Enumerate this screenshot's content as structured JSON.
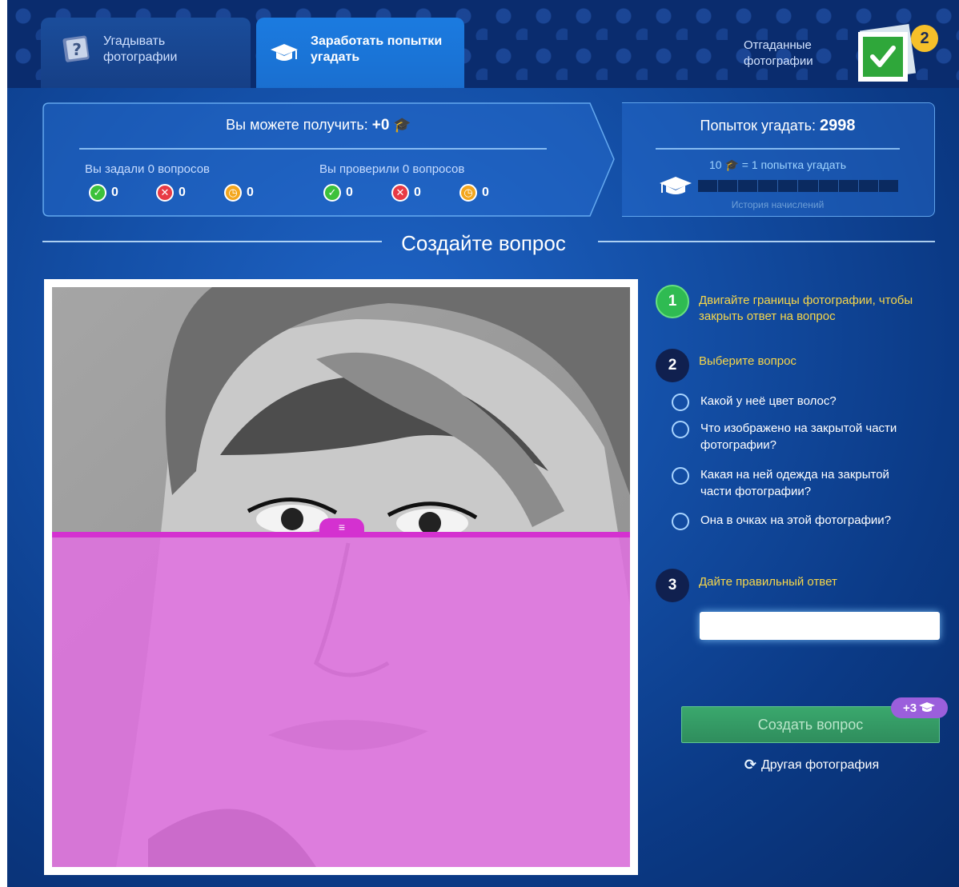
{
  "tabs": {
    "guess_label": "Угадывать фотографии",
    "earn_label": "Заработать попытки угадать",
    "guessed_label": "Отгаданные фотографии",
    "guessed_count": "2"
  },
  "stats": {
    "can_get_prefix": "Вы можете получить:",
    "can_get_value": "+0",
    "asked_label": "Вы задали 0 вопросов",
    "asked": {
      "ok": "0",
      "no": "0",
      "wait": "0"
    },
    "checked_label": "Вы проверили 0 вопросов",
    "checked": {
      "ok": "0",
      "no": "0",
      "wait": "0"
    },
    "attempts_prefix": "Попыток угадать:",
    "attempts_value": "2998",
    "rate_count": "10",
    "rate_rest": "= 1 попытка угадать",
    "progress_filled": 0,
    "history_label": "История начислений"
  },
  "section_title": "Создайте вопрос",
  "steps": [
    {
      "num": "1",
      "text": "Двигайте границы фотографии, чтобы закрыть ответ на вопрос"
    },
    {
      "num": "2",
      "text": "Выберите вопрос"
    },
    {
      "num": "3",
      "text": "Дайте правильный ответ"
    }
  ],
  "questions": [
    "Какой у неё цвет волос?",
    "Что изображено на закрытой части фотографии?",
    "Какая на ней одежда на закрытой части фотографии?",
    "Она в очках на этой фотографии?"
  ],
  "answer": {
    "value": "",
    "placeholder": ""
  },
  "create_button_label": "Создать вопрос",
  "bonus_label": "+3",
  "other_photo_label": "Другая фотография",
  "colors": {
    "accent_green": "#2fbb52",
    "step_text": "#f6d64a",
    "overlay": "#d431d0",
    "badge": "#f6c02a"
  }
}
